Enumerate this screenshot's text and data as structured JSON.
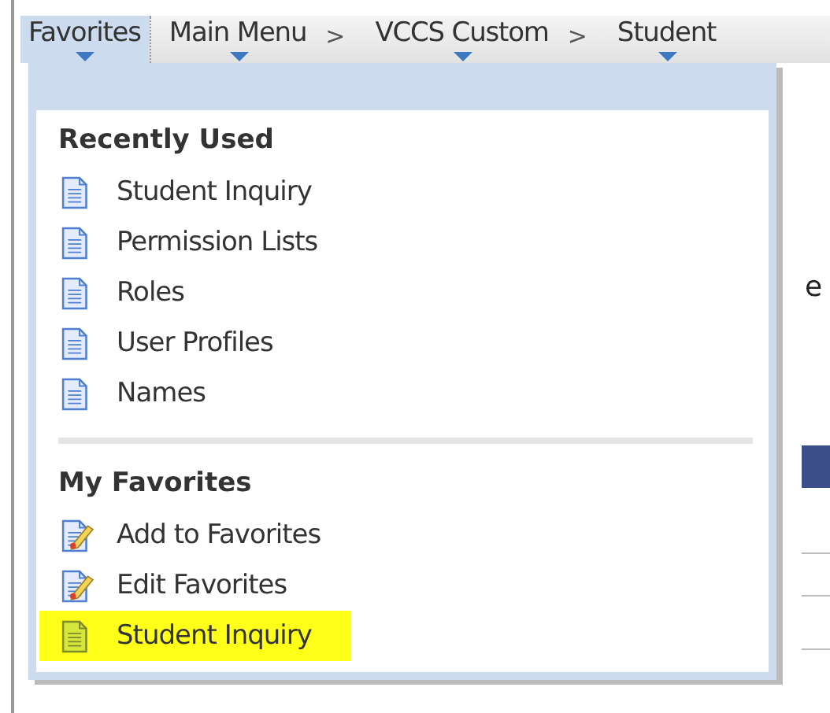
{
  "nav": [
    {
      "label": "Favorites",
      "selected": true
    },
    {
      "label": "Main Menu",
      "selected": false,
      "next": ">"
    },
    {
      "label": "VCCS Custom",
      "selected": false,
      "next": ">"
    },
    {
      "label": "Student",
      "selected": false
    }
  ],
  "menu": {
    "sections": [
      {
        "heading": "Recently Used",
        "items": [
          {
            "label": "Student Inquiry",
            "kind": "page",
            "highlighted": false
          },
          {
            "label": "Permission Lists",
            "kind": "page",
            "highlighted": false
          },
          {
            "label": "Roles",
            "kind": "page",
            "highlighted": false
          },
          {
            "label": "User Profiles",
            "kind": "page",
            "highlighted": false
          },
          {
            "label": "Names",
            "kind": "page",
            "highlighted": false
          }
        ]
      },
      {
        "heading": "My Favorites",
        "items": [
          {
            "label": "Add to Favorites",
            "kind": "edit",
            "highlighted": false
          },
          {
            "label": "Edit Favorites",
            "kind": "edit",
            "highlighted": false
          },
          {
            "label": "Student Inquiry",
            "kind": "page",
            "highlighted": true
          }
        ]
      }
    ]
  },
  "background": {
    "text": "e"
  }
}
